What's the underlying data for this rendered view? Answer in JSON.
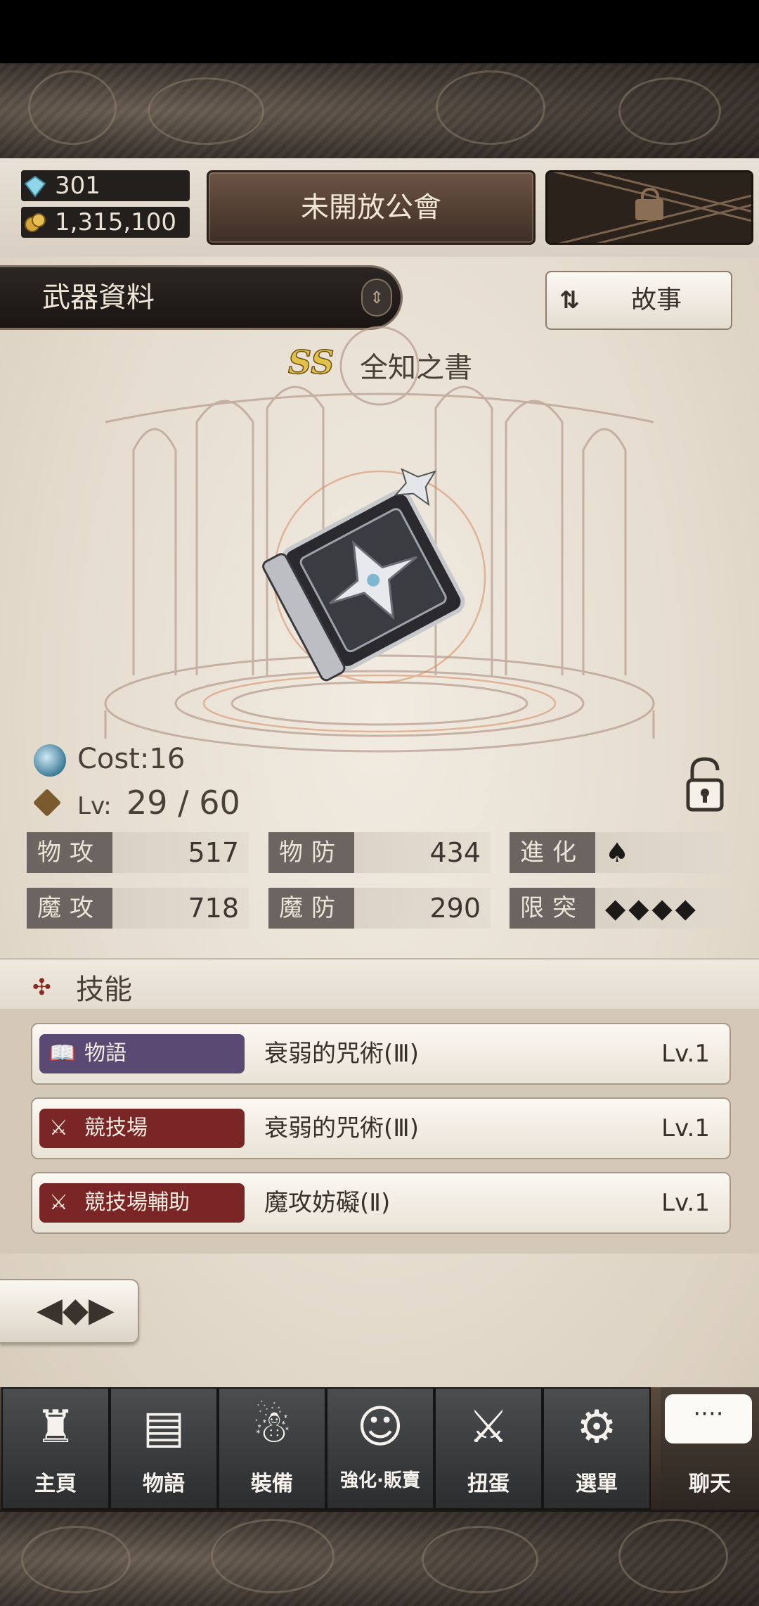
{
  "currency": {
    "gems": "301",
    "gold": "1,315,100"
  },
  "header": {
    "guild_button": "未開放公會",
    "locked_icon": "lock-icon"
  },
  "section": {
    "title": "武器資料",
    "story_button": "故事"
  },
  "weapon": {
    "rank": "SS",
    "name": "全知之書",
    "cost": "Cost:16",
    "lv_label": "Lv:",
    "lv_value": "29 / 60"
  },
  "stats": [
    {
      "key": "物攻",
      "value": "517"
    },
    {
      "key": "物防",
      "value": "434"
    },
    {
      "key": "進化",
      "value": "♠"
    },
    {
      "key": "魔攻",
      "value": "718"
    },
    {
      "key": "魔防",
      "value": "290"
    },
    {
      "key": "限突",
      "value": "◆◆◆◆"
    }
  ],
  "skills": {
    "title": "技能",
    "items": [
      {
        "tag": "物語",
        "tag_color": "#5a4a73",
        "icon": "📖",
        "name": "衰弱的咒術(Ⅲ)",
        "level": "Lv.1"
      },
      {
        "tag": "競技場",
        "tag_color": "#7a2626",
        "icon": "⚔",
        "name": "衰弱的咒術(Ⅲ)",
        "level": "Lv.1"
      },
      {
        "tag": "競技場輔助",
        "tag_color": "#7a2626",
        "icon": "⚔",
        "name": "魔攻妨礙(Ⅱ)",
        "level": "Lv.1"
      }
    ]
  },
  "nav": [
    {
      "label": "主頁",
      "icon": "castle-icon"
    },
    {
      "label": "物語",
      "icon": "book-icon"
    },
    {
      "label": "裝備",
      "icon": "puppet-icon"
    },
    {
      "label": "強化·販賣",
      "icon": "mask-icon"
    },
    {
      "label": "扭蛋",
      "icon": "sword-icon"
    },
    {
      "label": "選單",
      "icon": "gear-icon"
    }
  ],
  "chat": {
    "label": "聊天",
    "bubble": "····"
  }
}
